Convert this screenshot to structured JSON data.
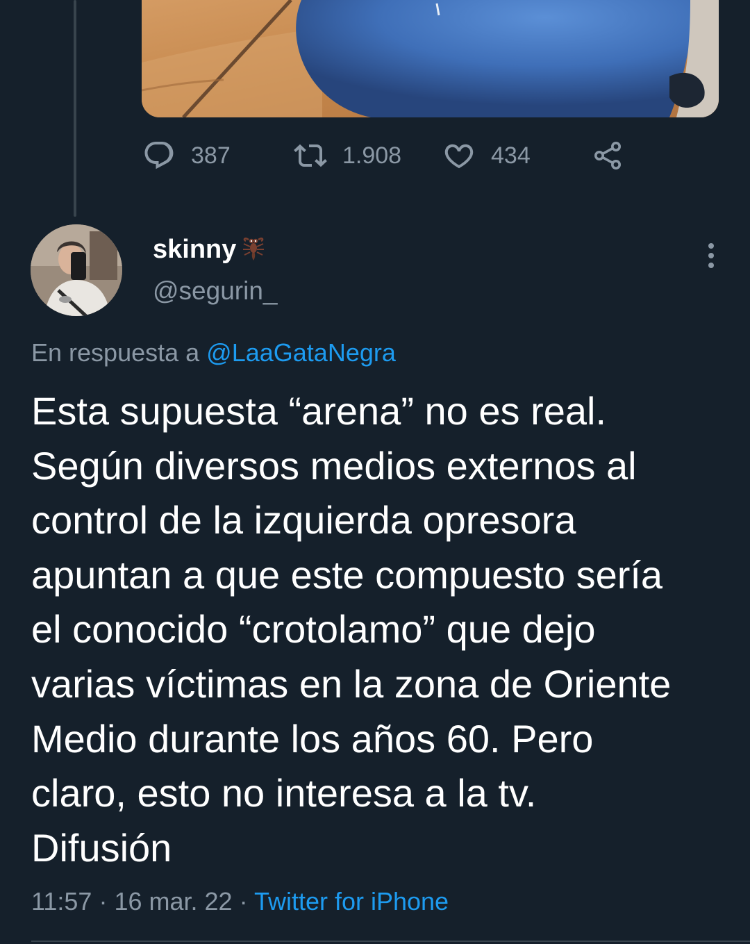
{
  "colors": {
    "background": "#15202b",
    "text": "#ffffff",
    "secondary_text": "#8b98a5",
    "accent": "#1d9bf0",
    "divider": "#38444d"
  },
  "parent_tweet": {
    "actions": {
      "reply": {
        "icon": "reply-icon",
        "count": "387"
      },
      "retweet": {
        "icon": "retweet-icon",
        "count": "1.908"
      },
      "like": {
        "icon": "heart-icon",
        "count": "434"
      },
      "share": {
        "icon": "share-icon"
      }
    }
  },
  "tweet": {
    "author": {
      "display_name": "skinny",
      "name_emoji": "scorpion-emoji",
      "handle": "@segurin_"
    },
    "reply_to": {
      "prefix": "En respuesta a",
      "mention": "@LaaGataNegra"
    },
    "text": "Esta supuesta “arena” no es real.\nSegún diversos medios externos al\ncontrol de la izquierda opresora\napuntan a que este compuesto sería\nel conocido “crotolamo” que dejo\nvarias víctimas en la zona de Oriente\nMedio durante los años 60. Pero\nclaro, esto no interesa a la tv.\nDifusión",
    "time": "11:57",
    "separator": "·",
    "date": "16 mar. 22",
    "source": "Twitter for iPhone"
  }
}
